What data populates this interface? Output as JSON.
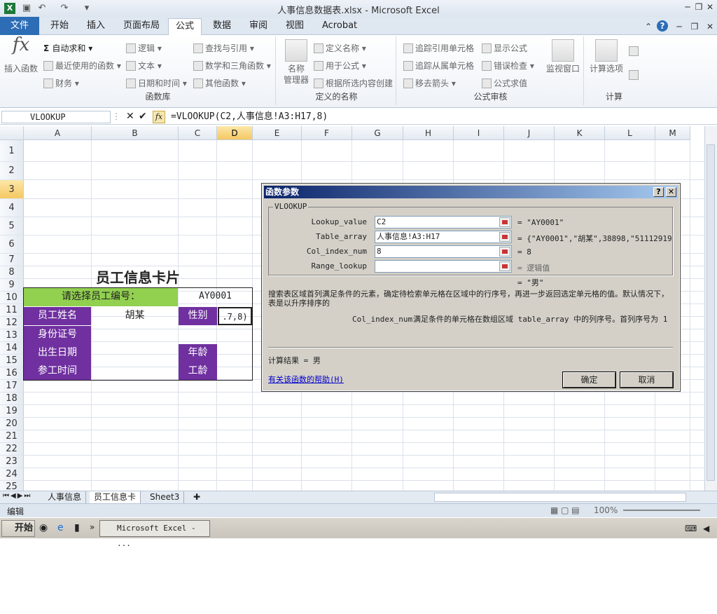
{
  "window": {
    "title": "人事信息数据表.xlsx - Microsoft Excel"
  },
  "ribbon_tabs": [
    "文件",
    "开始",
    "插入",
    "页面布局",
    "公式",
    "数据",
    "审阅",
    "视图",
    "Acrobat"
  ],
  "ribbon": {
    "insert_function": "插入函数",
    "library": {
      "autosum": "自动求和",
      "recent": "最近使用的函数",
      "finance": "财务",
      "logic": "逻辑",
      "text": "文本",
      "datetime": "日期和时间",
      "lookup": "查找与引用",
      "math": "数学和三角函数",
      "other": "其他函数",
      "label": "函数库"
    },
    "names": {
      "manager": "名称\n管理器",
      "define": "定义名称",
      "use": "用于公式",
      "create": "根据所选内容创建",
      "label": "定义的名称"
    },
    "audit": {
      "trace_prec": "追踪引用单元格",
      "trace_dep": "追踪从属单元格",
      "remove": "移去箭头",
      "show": "显示公式",
      "error": "错误检查",
      "eval": "公式求值",
      "watch": "监视窗口",
      "label": "公式审核"
    },
    "calc": {
      "options": "计算选项",
      "label": "计算"
    }
  },
  "formula_bar": {
    "name_box": "VLOOKUP",
    "formula": "=VLOOKUP(C2,人事信息!A3:H17,8)"
  },
  "columns": [
    "A",
    "B",
    "C",
    "D",
    "E",
    "F",
    "G",
    "H",
    "I",
    "J",
    "K",
    "L",
    "M"
  ],
  "rows": [
    "1",
    "2",
    "3",
    "4",
    "5",
    "6",
    "7",
    "8",
    "9",
    "10",
    "11",
    "12",
    "13",
    "14",
    "15",
    "16",
    "17",
    "18",
    "19",
    "20",
    "21",
    "22",
    "23",
    "24",
    "25"
  ],
  "card": {
    "title": "员工信息卡片",
    "select_label": "请选择员工编号：",
    "employee_id": "AY0001",
    "name_label": "员工姓名",
    "name_value": "胡某",
    "gender_label": "性别",
    "gender_cell": ".7,8)",
    "id_label": "身份证号",
    "birth_label": "出生日期",
    "age_label": "年龄",
    "work_label": "参工时间",
    "seniority_label": "工龄"
  },
  "dialog": {
    "title": "函数参数",
    "func": "VLOOKUP",
    "params": [
      {
        "label": "Lookup_value",
        "value": "C2",
        "result": "= \"AY0001\""
      },
      {
        "label": "Table_array",
        "value": "人事信息!A3:H17",
        "result": "= {\"AY0001\",\"胡某\",38898,\"511129198"
      },
      {
        "label": "Col_index_num",
        "value": "8",
        "result": "= 8"
      },
      {
        "label": "Range_lookup",
        "value": "",
        "result": "= 逻辑值"
      }
    ],
    "overall_result": "= \"男\"",
    "description": "搜索表区域首列满足条件的元素，确定待检索单元格在区域中的行序号，再进一步返回选定单元格的值。默认情况下，表是以升序排序的",
    "param_name": "Col_index_num",
    "param_desc": "满足条件的单元格在数组区域 table_array 中的列序号。首列序号为 1",
    "calc_result": "计算结果 = 男",
    "help_link": "有关该函数的帮助(H)",
    "ok": "确定",
    "cancel": "取消"
  },
  "sheet_tabs": [
    "人事信息",
    "员工信息卡",
    "Sheet3"
  ],
  "status": {
    "mode": "编辑",
    "zoom": "100%"
  },
  "taskbar": {
    "start": "开始",
    "excel": "Microsoft Excel - ..."
  }
}
